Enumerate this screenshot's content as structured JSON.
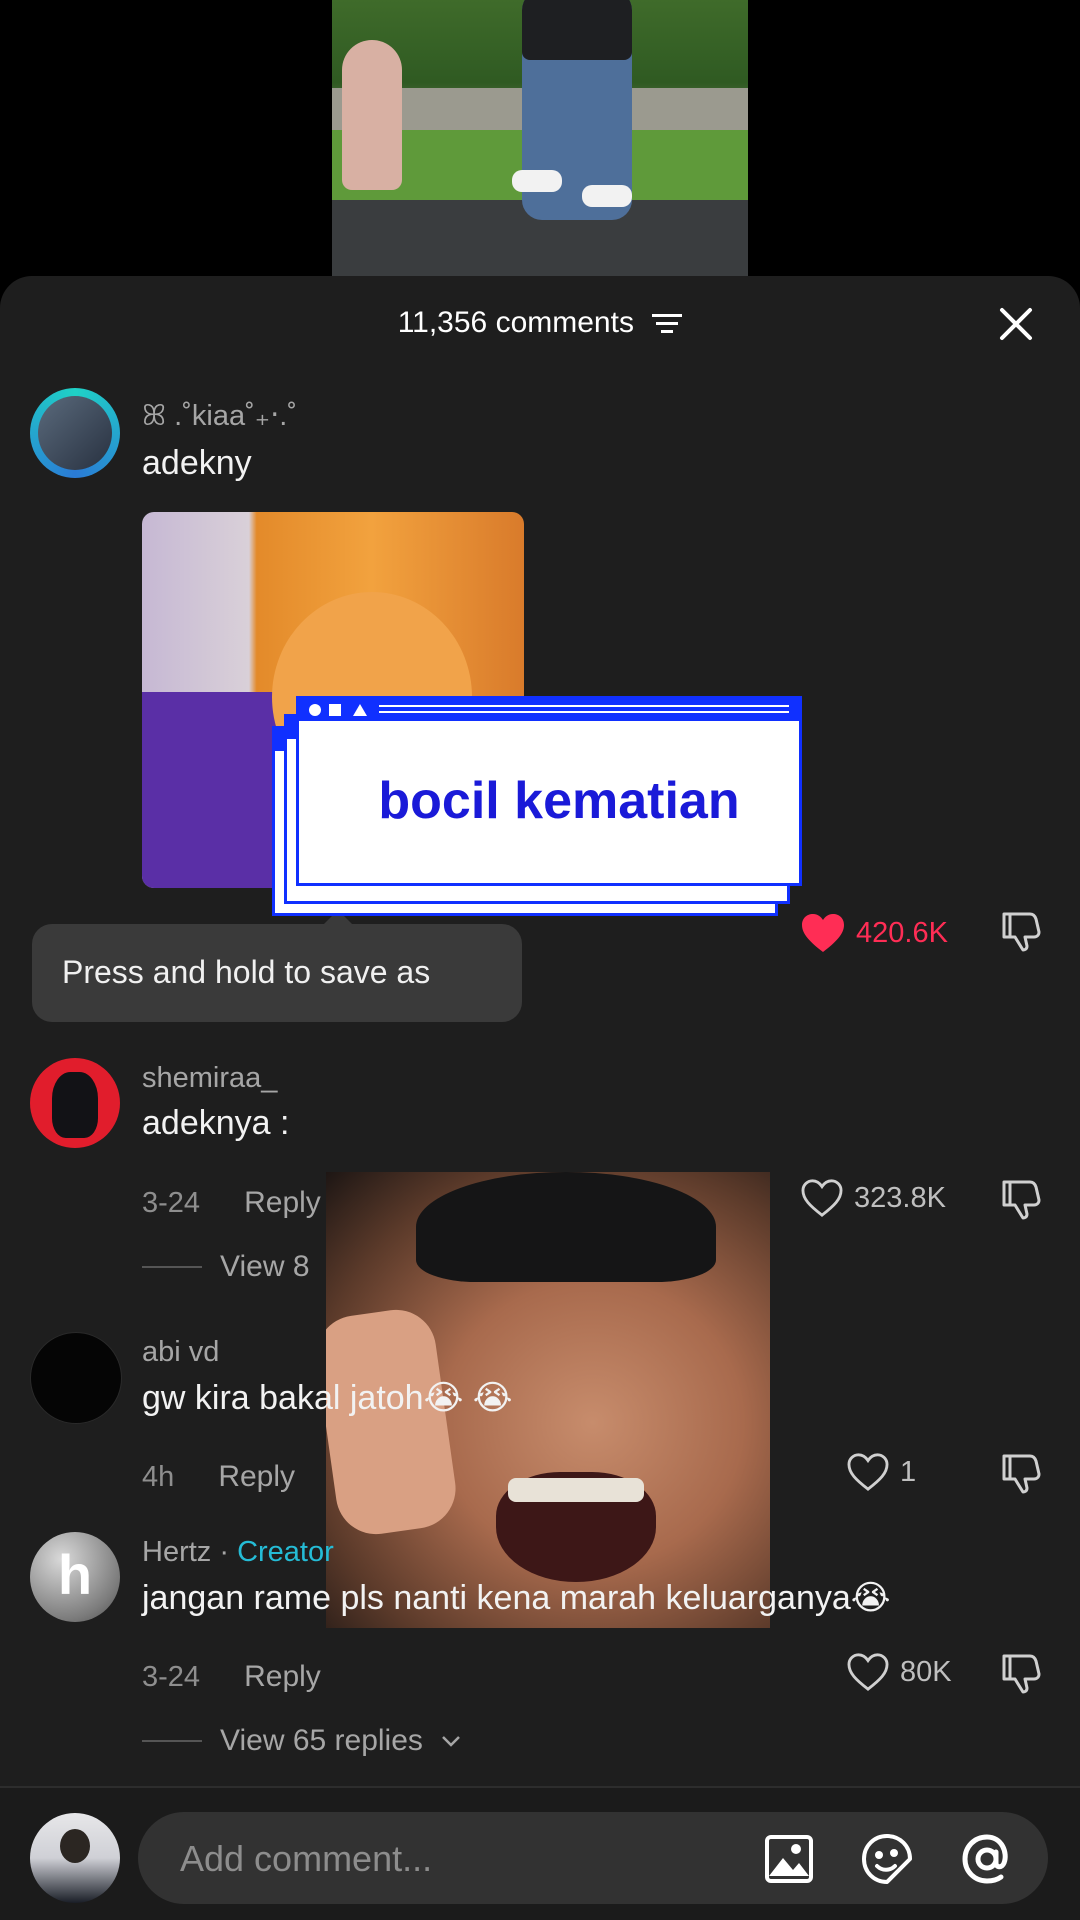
{
  "header": {
    "comments_count": "11,356 comments"
  },
  "tooltip": {
    "text": "Press and hold to save as"
  },
  "sticker_popup": {
    "title": "bocil kematian"
  },
  "comments": [
    {
      "username": "ꕤ .˚kiaa˚₊‧.˚",
      "text": "adekny",
      "like_count": "420.6K",
      "liked": true
    },
    {
      "username": "shemiraa_",
      "text": "adeknya :",
      "date": "3-24",
      "reply_label": "Reply",
      "like_count": "323.8K",
      "view_replies": "View 8"
    },
    {
      "username": "abi vd",
      "text": "gw kira bakal jatoh😭 😭",
      "date": "4h",
      "reply_label": "Reply",
      "like_count": "1"
    },
    {
      "username": "Hertz",
      "creator_label": "Creator",
      "text": "jangan rame pls nanti kena marah keluarganya😭",
      "date": "3-24",
      "reply_label": "Reply",
      "like_count": "80K",
      "view_replies": "View 65 replies"
    }
  ],
  "composer": {
    "placeholder": "Add comment..."
  },
  "colors": {
    "like_red": "#ff2d55",
    "creator": "#25bcd6",
    "sticker_blue": "#1030ff"
  }
}
